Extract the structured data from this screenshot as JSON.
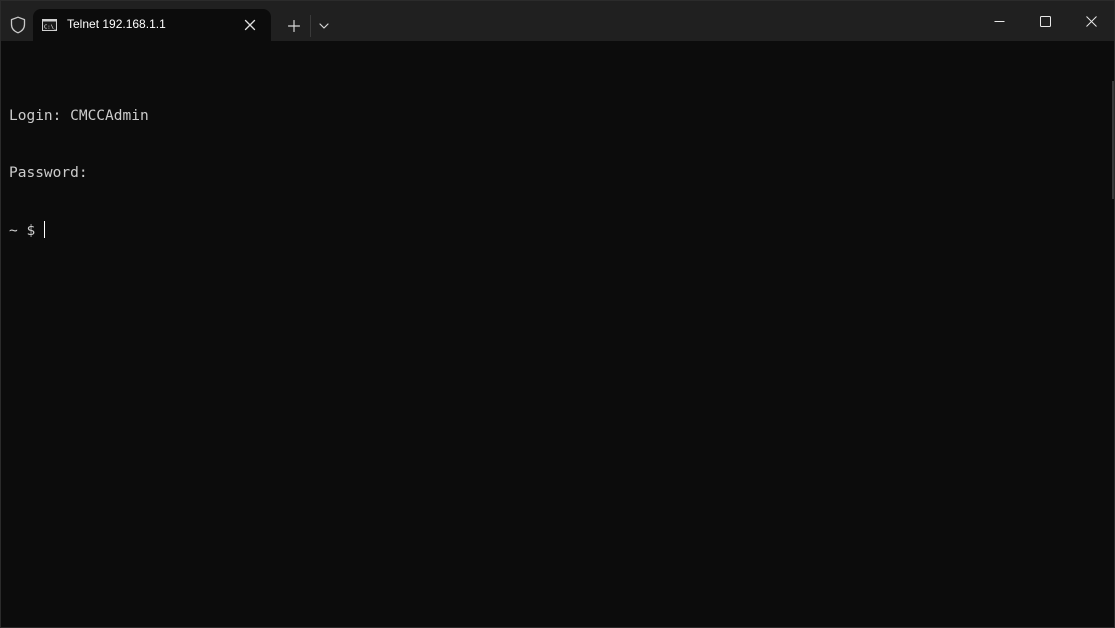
{
  "window": {
    "tab_title": "Telnet 192.168.1.1",
    "tab_icon": "cmd-icon",
    "shield_icon": "shield-icon"
  },
  "tabbar": {
    "new_tab_icon": "plus-icon",
    "dropdown_icon": "chevron-down-icon"
  },
  "controls": {
    "minimize_icon": "minimize-icon",
    "maximize_icon": "maximize-icon",
    "close_icon": "close-icon"
  },
  "terminal": {
    "lines": [
      "Login: CMCCAdmin",
      "Password:",
      "~ $ "
    ],
    "colors": {
      "background": "#0c0c0c",
      "foreground": "#cccccc",
      "titlebar": "#202020"
    }
  }
}
